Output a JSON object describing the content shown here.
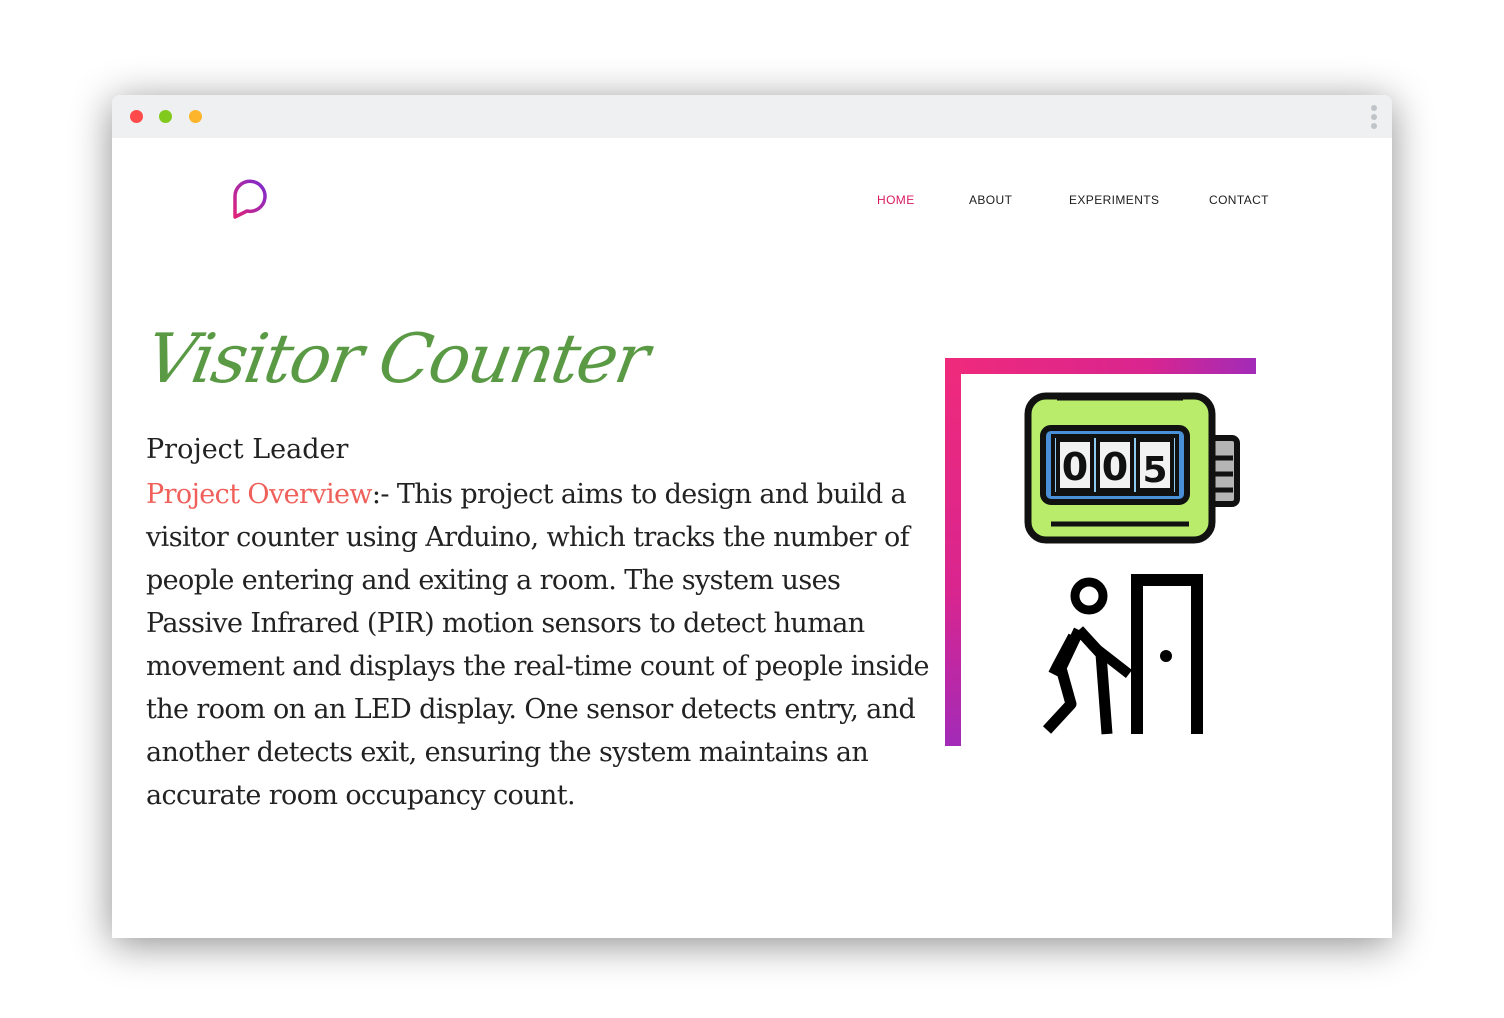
{
  "window": {
    "controls": [
      "close",
      "minimize",
      "maximize"
    ],
    "menu_icon": "kebab-menu-icon"
  },
  "header": {
    "logo_icon": "chat-bubble-logo-icon",
    "nav": {
      "home": "HOME",
      "about": "ABOUT",
      "experiments": "EXPERIMENTS",
      "contact": "CONTACT"
    },
    "active_item": "HOME"
  },
  "main": {
    "title": "Visitor Counter",
    "leader_label": "Project Leader",
    "overview_label": "Project Overview",
    "overview_text": ":- This project aims to design and build a visitor counter using Arduino, which tracks the number of people entering and exiting a room. The system uses Passive Infrared (PIR) motion sensors to detect human movement and displays the real-time count of people inside the room on an LED display. One sensor detects entry, and another detects exit, ensuring the system maintains an accurate room occupancy count.",
    "illustration": {
      "counter_digits": [
        "0",
        "0",
        "5"
      ],
      "counter_icon": "mechanical-counter-icon",
      "person_icon": "person-walking-through-door-icon"
    }
  },
  "colors": {
    "accent": "#d81b60",
    "title": "#5a9a45",
    "overview_label": "#f0605a",
    "frame_gradient_start": "#ef2a7b",
    "frame_gradient_end": "#a22bb8",
    "counter_body": "#b8ec6a",
    "counter_screen": "#8ecbf0"
  }
}
